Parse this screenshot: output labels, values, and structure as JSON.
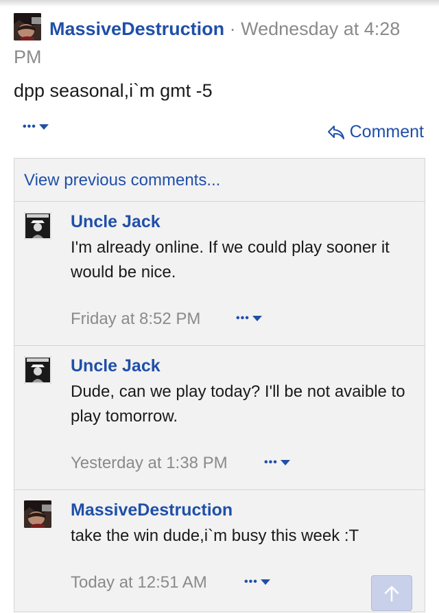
{
  "post": {
    "author": "MassiveDestruction",
    "separator": "·",
    "timestamp": "Wednesday at 4:28 PM",
    "body": "dpp seasonal,i`m gmt -5",
    "menu_dots": "•••",
    "comment_label": "Comment"
  },
  "comments": {
    "view_previous_label": "View previous comments...",
    "items": [
      {
        "author": "Uncle Jack",
        "text": "I'm already online. If we could play sooner it would be nice.",
        "timestamp": "Friday at 8:52 PM",
        "menu_dots": "•••"
      },
      {
        "author": "Uncle Jack",
        "text": "Dude, can we play today? I'll be not avaible to play tomorrow.",
        "timestamp": "Yesterday at 1:38 PM",
        "menu_dots": "•••"
      },
      {
        "author": "MassiveDestruction",
        "text": "take the win dude,i`m busy this week :T",
        "timestamp": "Today at 12:51 AM",
        "menu_dots": "•••"
      }
    ]
  },
  "icons": {
    "reply": "reply-arrow-icon",
    "caret": "caret-down-icon",
    "scroll_top": "arrow-up-icon"
  },
  "colors": {
    "link": "#1f4fa8",
    "muted": "#8a8a8a",
    "comment_bg": "#f2f2f2",
    "border": "#d4d4d4",
    "scroll_button": "#c9d1ea"
  }
}
